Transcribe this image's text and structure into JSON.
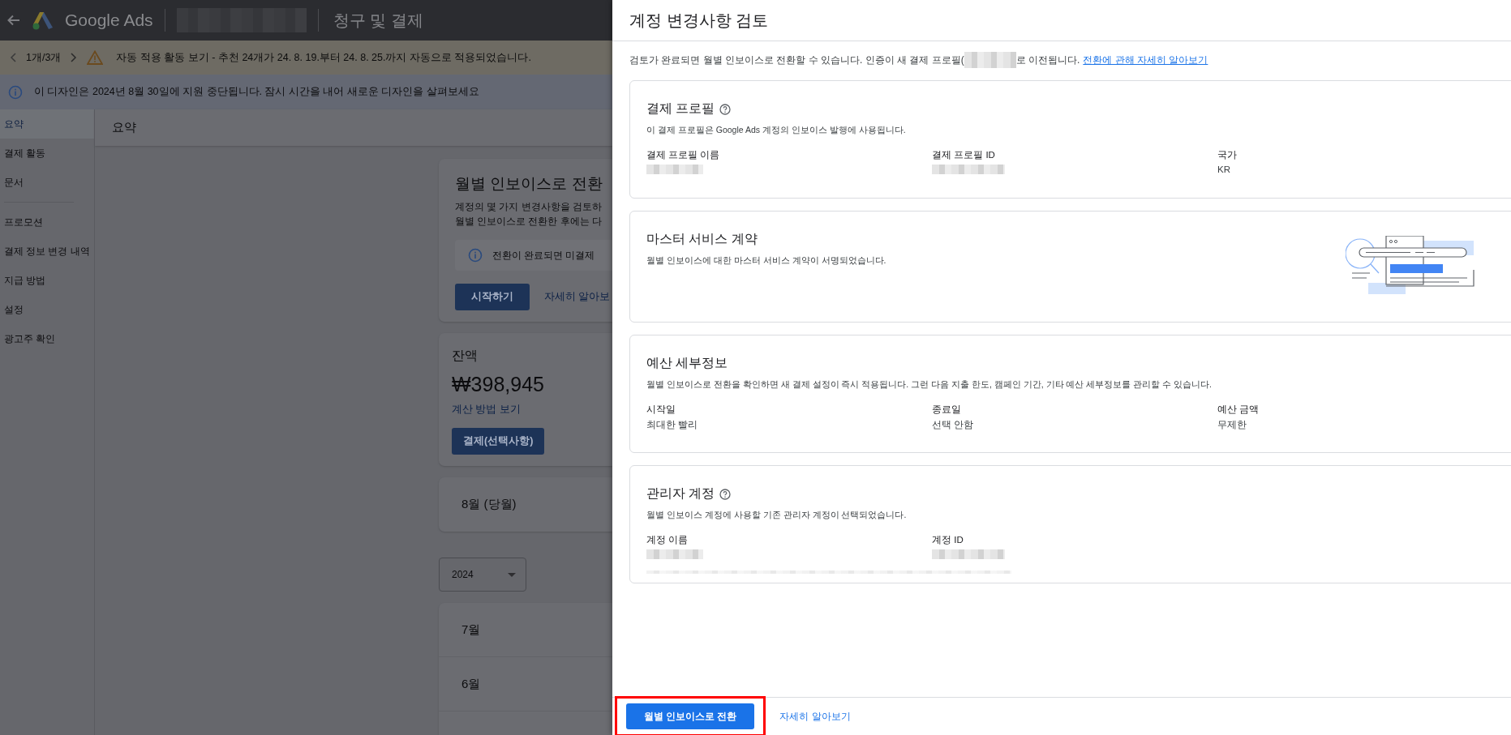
{
  "top_bar": {
    "product": "Google Ads",
    "page_title": "청구 및 결제"
  },
  "notice_bar": {
    "pager": "1개/3개",
    "message": "자동 적용 활동 보기 - 추천 24개가 24. 8. 19.부터 24. 8. 25.까지 자동으로 적용되었습니다."
  },
  "info_bar": {
    "message": "이 디자인은 2024년 8월 30일에 지원 중단됩니다. 잠시 시간을 내어 새로운 디자인을 살펴보세요"
  },
  "sidebar": {
    "items": [
      {
        "label": "요약",
        "selected": true
      },
      {
        "label": "결제 활동",
        "selected": false
      },
      {
        "label": "문서",
        "selected": false
      },
      {
        "label": "프로모션",
        "selected": false
      },
      {
        "label": "결제 정보 변경 내역",
        "selected": false
      },
      {
        "label": "지급 방법",
        "selected": false
      },
      {
        "label": "설정",
        "selected": false
      },
      {
        "label": "광고주 확인",
        "selected": false
      }
    ]
  },
  "summary_header": "요약",
  "switch_card": {
    "title": "월별 인보이스로 전환",
    "lines": [
      "계정의 몇 가지 변경사항을 검토하",
      "월별 인보이스로 전환한 후에는 다"
    ],
    "notice": "전환이 완료되면 미결제",
    "start_button": "시작하기",
    "learn_link": "자세히 알아보"
  },
  "balance_card": {
    "label": "잔액",
    "amount": "₩398,945",
    "link": "계산 방법 보기",
    "pay_button": "결제(선택사항)"
  },
  "current_month_card": {
    "label": "8월 (당월)"
  },
  "year_select": {
    "value": "2024"
  },
  "months": [
    "7월",
    "6월"
  ],
  "panel": {
    "title": "계정 변경사항 검토",
    "intro_before": "검토가 완료되면 월별 인보이스로 전환할 수 있습니다. 인증이 새 결제 프로필(",
    "intro_after": "로 이전됩니다.",
    "intro_link": "전환에 관해 자세히 알아보기",
    "sections": [
      {
        "kind": "fields",
        "title": "결제 프로필",
        "help": true,
        "description": "이 결제 프로필은 Google Ads 계정의 인보이스 발행에 사용됩니다.",
        "fields": [
          {
            "label": "결제 프로필 이름"
          },
          {
            "label": "결제 프로필 ID"
          },
          {
            "label": "국가",
            "value": "KR"
          }
        ]
      },
      {
        "kind": "illustration",
        "title": "마스터 서비스 계약",
        "help": false,
        "description": "월별 인보이스에 대한 마스터 서비스 계약이 서명되었습니다."
      },
      {
        "kind": "fields",
        "title": "예산 세부정보",
        "help": false,
        "description": "월별 인보이스로 전환을 확인하면 새 결제 설정이 즉시 적용됩니다. 그런 다음 지출 한도, 캠페인 기간, 기타 예산 세부정보를 관리할 수 있습니다.",
        "fields": [
          {
            "label": "시작일",
            "value": "최대한 빨리"
          },
          {
            "label": "종료일",
            "value": "선택 안함"
          },
          {
            "label": "예산 금액",
            "value": "무제한"
          }
        ]
      },
      {
        "kind": "fields",
        "title": "관리자 계정",
        "help": true,
        "description": "월별 인보이스 계정에 사용할 기존 관리자 계정이 선택되었습니다.",
        "fields": [
          {
            "label": "계정 이름"
          },
          {
            "label": "계정 ID"
          }
        ]
      }
    ],
    "confirm_button": "월별 인보이스로 전환",
    "footer_link": "자세히 알아보기"
  }
}
